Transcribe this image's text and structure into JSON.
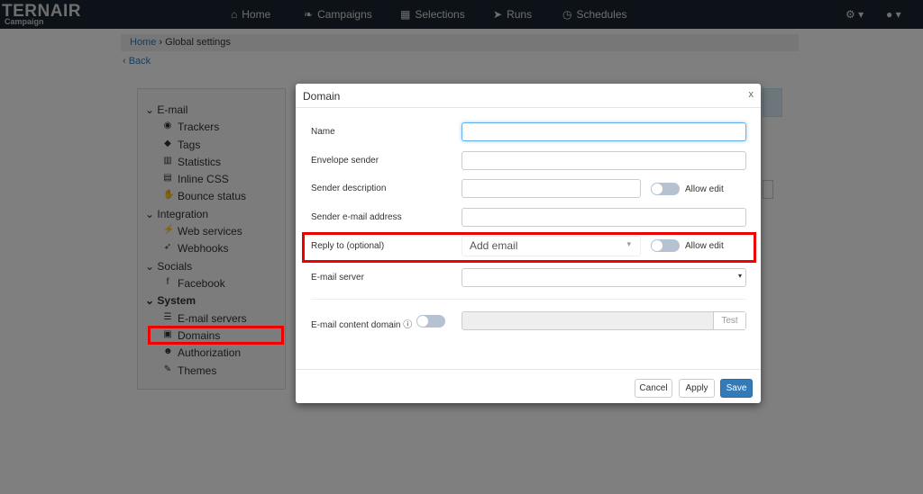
{
  "navbar": {
    "logo": "TERNAIR",
    "logo_sub": "Campaign",
    "items": [
      {
        "label": "Home",
        "icon": "home-icon"
      },
      {
        "label": "Campaigns",
        "icon": "leaf-icon"
      },
      {
        "label": "Selections",
        "icon": "cubes-icon"
      },
      {
        "label": "Runs",
        "icon": "paper-plane-icon"
      },
      {
        "label": "Schedules",
        "icon": "clock-icon"
      }
    ]
  },
  "breadcrumb": {
    "home": "Home",
    "sep": "›",
    "current": "Global settings"
  },
  "back": "‹ Back",
  "sidebar": {
    "email": "E-mail",
    "trackers": "Trackers",
    "tags": "Tags",
    "statistics": "Statistics",
    "inline_css": "Inline CSS",
    "bounce": "Bounce status",
    "integration": "Integration",
    "web_services": "Web services",
    "webhooks": "Webhooks",
    "socials": "Socials",
    "facebook": "Facebook",
    "system": "System",
    "email_servers": "E-mail servers",
    "domains": "Domains",
    "authorization": "Authorization",
    "themes": "Themes"
  },
  "modal": {
    "title": "Domain",
    "close": "x",
    "name_label": "Name",
    "name_value": "",
    "envelope_label": "Envelope sender",
    "envelope_value": "",
    "sender_desc_label": "Sender description",
    "sender_desc_value": "",
    "allow_edit": "Allow edit",
    "sender_email_label": "Sender e-mail address",
    "sender_email_value": "",
    "reply_label": "Reply to (optional)",
    "reply_placeholder": "Add email",
    "server_label": "E-mail server",
    "server_value": "",
    "content_domain_label": "E-mail content domain",
    "content_domain_value": "",
    "test": "Test",
    "cancel": "Cancel",
    "apply": "Apply",
    "save": "Save"
  }
}
